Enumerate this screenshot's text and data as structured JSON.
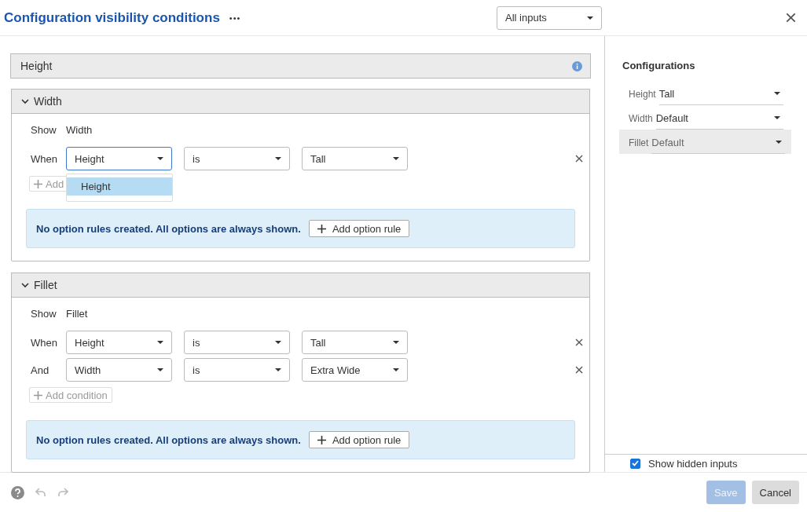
{
  "window": {
    "title": "Configuration visibility conditions",
    "more": "•••",
    "filter": "All inputs"
  },
  "sections": [
    {
      "title": "Height",
      "expanded": false,
      "info": true
    },
    {
      "title": "Width",
      "expanded": true,
      "show_label": "Show",
      "show_value": "Width",
      "conditions": [
        {
          "connector": "When",
          "field": "Height",
          "operator": "is",
          "value": "Tall",
          "focused": true
        }
      ],
      "menu": {
        "items": [
          {
            "label": "Height",
            "selected": true
          }
        ]
      },
      "add_condition": {
        "label": "Add",
        "disabled": true
      },
      "notice": {
        "text": "No option rules created. All options are always shown.",
        "button": "Add option rule"
      }
    },
    {
      "title": "Fillet",
      "expanded": true,
      "show_label": "Show",
      "show_value": "Fillet",
      "conditions": [
        {
          "connector": "When",
          "field": "Height",
          "operator": "is",
          "value": "Tall",
          "focused": false
        },
        {
          "connector": "And",
          "field": "Width",
          "operator": "is",
          "value": "Extra Wide",
          "focused": false
        }
      ],
      "add_condition": {
        "label": "Add condition",
        "disabled": true
      },
      "notice": {
        "text": "No option rules created. All options are always shown.",
        "button": "Add option rule"
      }
    }
  ],
  "configurations": {
    "title": "Configurations",
    "items": [
      {
        "label": "Height",
        "value": "Tall",
        "highlighted": false
      },
      {
        "label": "Width",
        "value": "Default",
        "highlighted": false
      },
      {
        "label": "Fillet",
        "value": "Default",
        "highlighted": true
      }
    ],
    "show_hidden": {
      "label": "Show hidden inputs",
      "checked": true
    }
  },
  "footer": {
    "undo_disabled": true,
    "redo_disabled": true,
    "buttons": [
      {
        "label": "Save",
        "kind": "primary",
        "disabled": true
      },
      {
        "label": "Cancel",
        "kind": "secondary",
        "disabled": false
      }
    ]
  }
}
